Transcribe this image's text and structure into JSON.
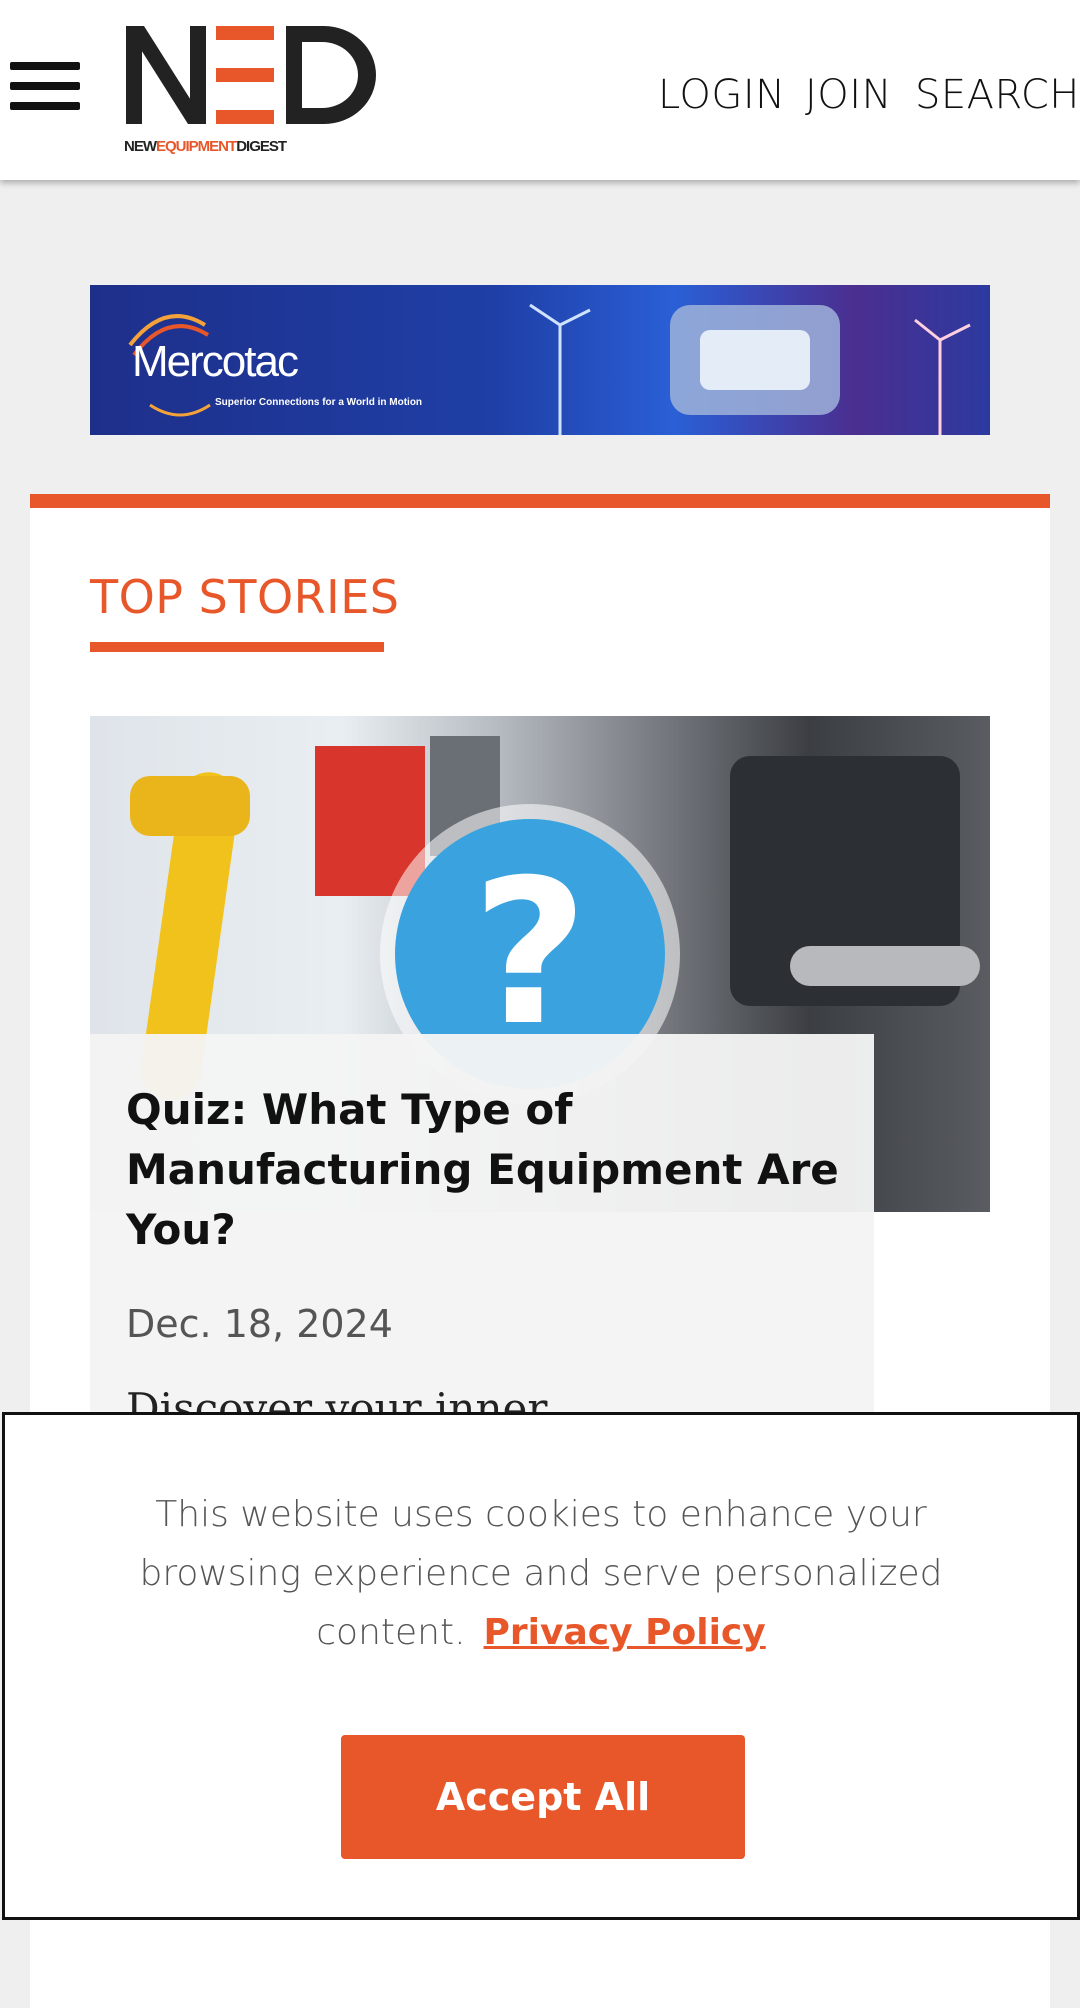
{
  "header": {
    "logo_letters": "NED",
    "logo_sub_new": "NEW",
    "logo_sub_equipment": "EQUIPMENT",
    "logo_sub_digest": "DIGEST",
    "nav": {
      "login": "LOGIN",
      "join": "JOIN",
      "search": "SEARCH"
    }
  },
  "ad": {
    "brand": "Mercotac",
    "tagline": "Superior Connections for a World in Motion"
  },
  "top_stories": {
    "heading": "TOP STORIES",
    "story": {
      "title": "Quiz: What Type of Manufacturing Equipment Are You?",
      "date": "Dec. 18, 2024",
      "excerpt": "Discover your inner"
    }
  },
  "cookie_banner": {
    "text": "This website uses cookies to enhance your browsing experience and serve personalized content.",
    "privacy_link": "Privacy Policy",
    "accept_button": "Accept All"
  },
  "colors": {
    "accent": "#e8572a",
    "quiz_blue": "#3aa3df",
    "background": "#efefef"
  }
}
